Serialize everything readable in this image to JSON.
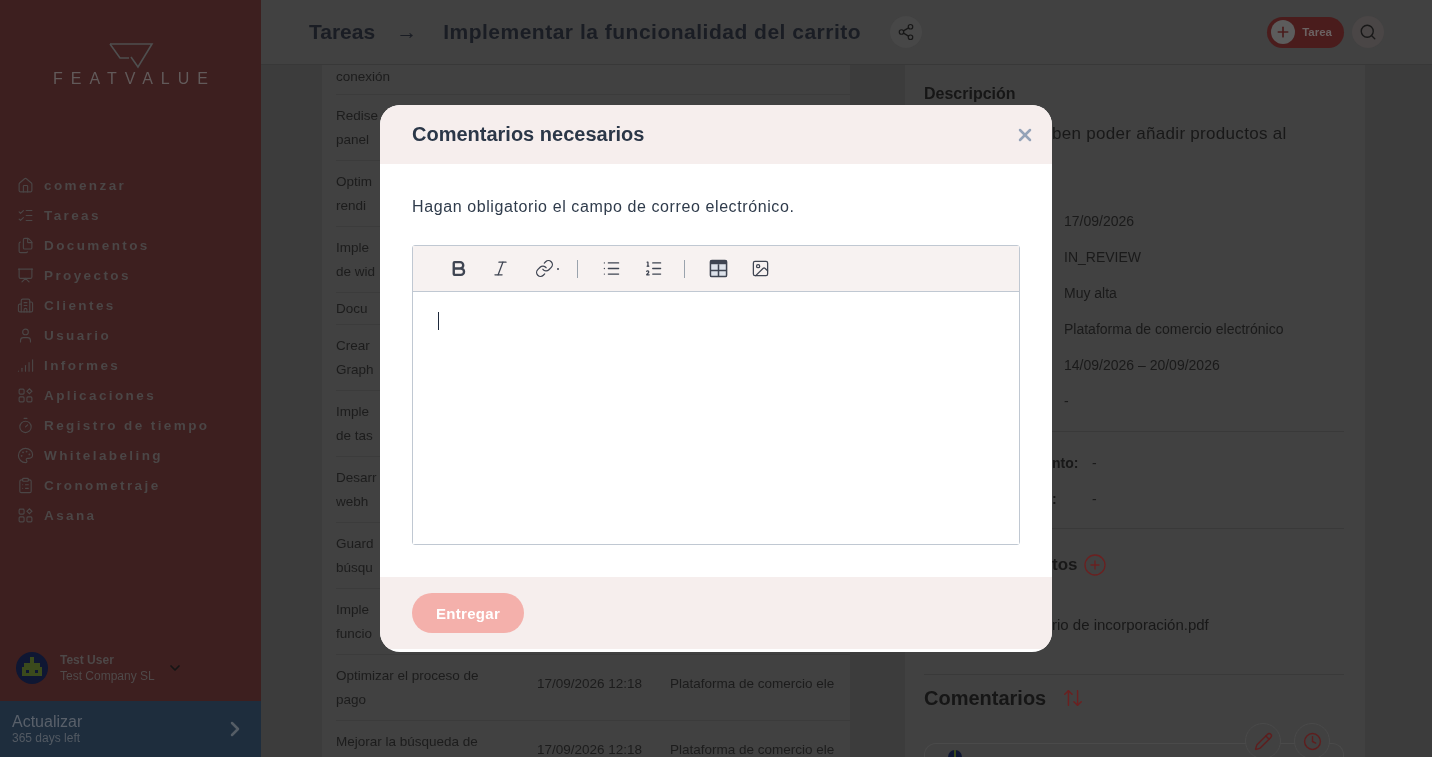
{
  "sidebar": {
    "brand": "FEATVALUE",
    "nav_items": [
      "comenzar",
      "Tareas",
      "Documentos",
      "Proyectos",
      "Clientes",
      "Usuario",
      "Informes",
      "Aplicaciones",
      "Registro de tiempo",
      "Whitelabeling",
      "Cronometraje",
      "Asana"
    ],
    "user": {
      "name": "Test User",
      "company": "Test Company SL"
    },
    "upgrade": {
      "title": "Actualizar",
      "subtitle": "365 days left"
    }
  },
  "header": {
    "breadcrumb": "Tareas",
    "separator": "→",
    "title": "Implementar la funcionalidad del carrito",
    "new_task_label": "Tarea"
  },
  "task_table": {
    "rows": [
      {
        "name": "conexión"
      },
      {
        "name": "Redise\npanel"
      },
      {
        "name": "Optim\nrendi"
      },
      {
        "name": "Imple\nde wid"
      },
      {
        "name": "Docu"
      },
      {
        "name": "Crear\nGraph"
      },
      {
        "name": "Imple\nde tas"
      },
      {
        "name": "Desarr\nwebh"
      },
      {
        "name": "Guard\nbúsqu"
      },
      {
        "name": "Imple\nfuncio"
      },
      {
        "name": "Optimizar el proceso de\npago",
        "date": "17/09/2026 12:18",
        "project": "Plataforma de comercio ele"
      },
      {
        "name": "Mejorar la búsqueda de",
        "date": "17/09/2026 12:18",
        "project": "Plataforma de comercio ele"
      }
    ]
  },
  "detail_panel": {
    "description_heading": "Descripción",
    "description_text": "ben poder añadir productos al",
    "field_values": [
      "17/09/2026",
      "IN_REVIEW",
      "Muy alta",
      "Plataforma de comercio electrónico",
      "14/09/2026 – 20/09/2026",
      "-"
    ],
    "extra_fields": [
      {
        "label": "nto:",
        "value": "-"
      },
      {
        "label": ":",
        "value": "-"
      }
    ],
    "documents_heading": "tos",
    "documents": [
      "rio de incorporación.pdf"
    ],
    "comments_heading": "Comentarios"
  },
  "modal": {
    "title": "Comentarios necesarios",
    "prompt": "Hagan obligatorio el campo de correo electrónico.",
    "toolbar": [
      {
        "kind": "bold"
      },
      {
        "kind": "italic"
      },
      {
        "kind": "link"
      },
      {
        "kind": "separator"
      },
      {
        "kind": "bullet_list"
      },
      {
        "kind": "numbered_list"
      },
      {
        "kind": "separator"
      },
      {
        "kind": "table"
      },
      {
        "kind": "image"
      }
    ],
    "editor": {
      "focused": true
    },
    "submit": {
      "label": "Entregar",
      "disabled": true
    }
  }
}
